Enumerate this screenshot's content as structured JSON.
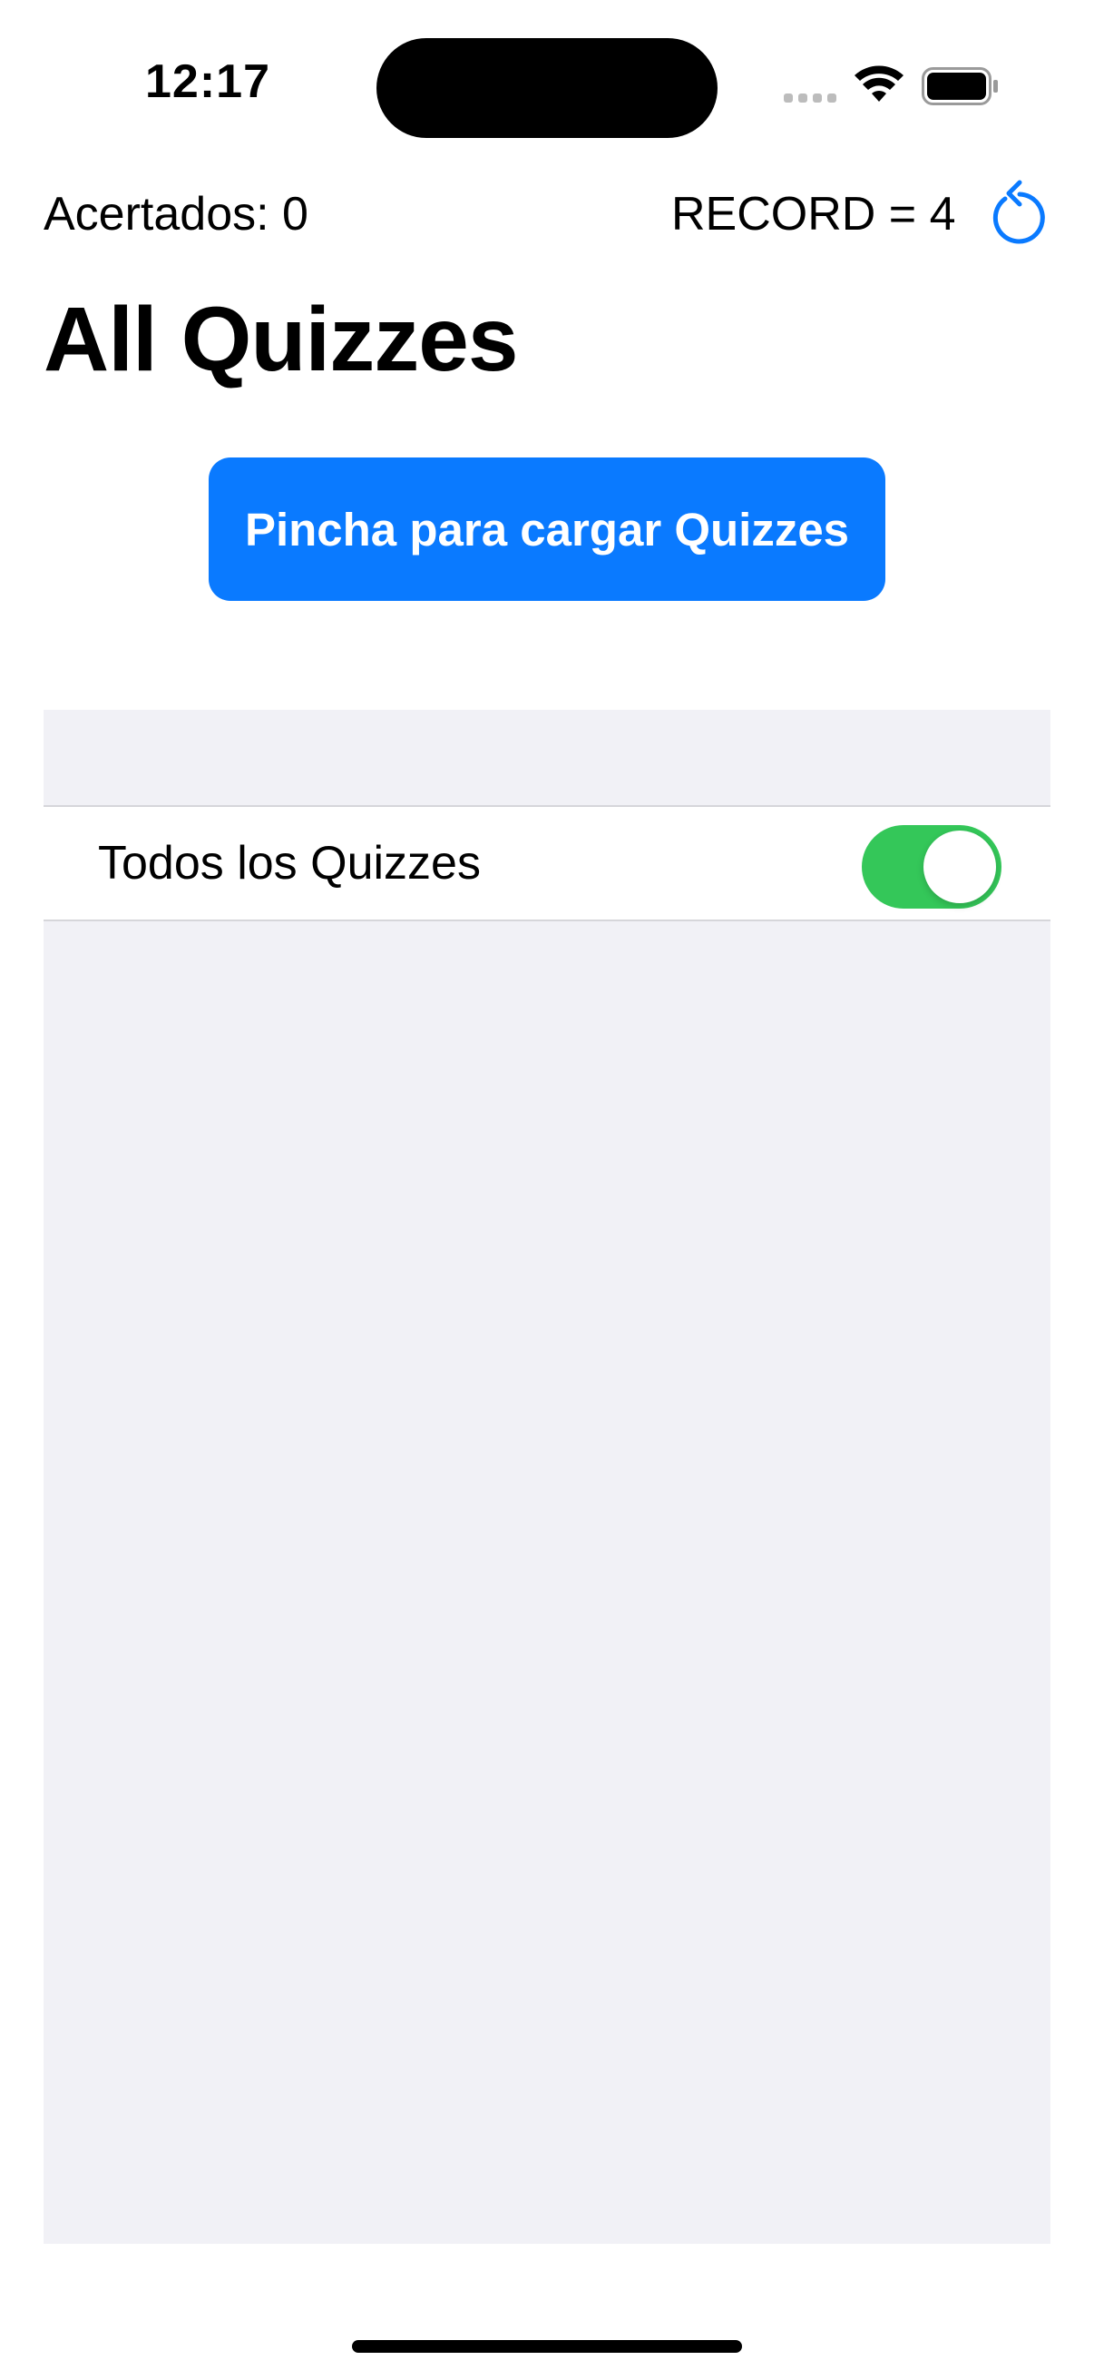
{
  "status_bar": {
    "time": "12:17",
    "icons": [
      "cellular-signal-icon",
      "wifi-icon",
      "battery-icon"
    ]
  },
  "nav": {
    "score_text": "Acertados: 0",
    "record_text": "RECORD = 4",
    "reload_icon": "reload-icon"
  },
  "page": {
    "title": "All Quizzes"
  },
  "load_button": {
    "label": "Pincha para cargar Quizzes"
  },
  "list": {
    "rows": [
      {
        "label": "Todos los Quizzes",
        "toggle_on": true
      }
    ]
  },
  "colors": {
    "accent": "#0a7aff",
    "toggle_on": "#34c759",
    "grouped_background": "#f1f1f6"
  }
}
